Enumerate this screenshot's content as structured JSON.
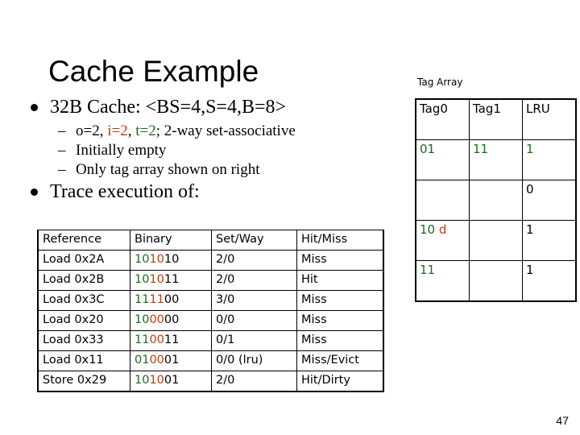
{
  "slide": {
    "title": "Cache Example",
    "page_number": "47"
  },
  "colors": {
    "tag_green": "#1a6b22",
    "index_red": "#c03b10",
    "text_black": "#000000",
    "background": "#ffffff"
  },
  "body": {
    "bullet1": {
      "text": "32B Cache: <BS=4,S=4,B=8>"
    },
    "sub_bullets": [
      {
        "dash": "–",
        "parts": [
          {
            "text": "o=2, ",
            "color": "black"
          },
          {
            "text": "i=2",
            "color": "red"
          },
          {
            "text": ", ",
            "color": "black"
          },
          {
            "text": "t=2",
            "color": "green"
          },
          {
            "text": "; 2-way set-associative",
            "color": "black"
          }
        ],
        "plain": "o=2, i=2, t=2; 2-way set-associative"
      },
      {
        "dash": "–",
        "plain": "Initially empty"
      },
      {
        "dash": "–",
        "plain": "Only tag array shown on right"
      }
    ],
    "bullet2": {
      "text": "Trace execution of:"
    }
  },
  "trace_table": {
    "headers": [
      "Reference",
      "Binary",
      "Set/Way",
      "Hit/Miss"
    ],
    "rows": [
      {
        "reference": "Load 0x2A",
        "binary": "101010",
        "binary_tag": "10",
        "binary_index": "10",
        "binary_offset": "10",
        "set_way": "2/0",
        "hit_miss": "Miss"
      },
      {
        "reference": "Load 0x2B",
        "binary": "101011",
        "binary_tag": "10",
        "binary_index": "10",
        "binary_offset": "11",
        "set_way": "2/0",
        "hit_miss": "Hit"
      },
      {
        "reference": "Load 0x3C",
        "binary": "111100",
        "binary_tag": "11",
        "binary_index": "11",
        "binary_offset": "00",
        "set_way": "3/0",
        "hit_miss": "Miss"
      },
      {
        "reference": "Load 0x20",
        "binary": "100000",
        "binary_tag": "10",
        "binary_index": "00",
        "binary_offset": "00",
        "set_way": "0/0",
        "hit_miss": "Miss"
      },
      {
        "reference": "Load 0x33",
        "binary": "110011",
        "binary_tag": "11",
        "binary_index": "00",
        "binary_offset": "11",
        "set_way": "0/1",
        "hit_miss": "Miss"
      },
      {
        "reference": "Load 0x11",
        "binary": "010001",
        "binary_tag": "01",
        "binary_index": "00",
        "binary_offset": "01",
        "set_way": "0/0 (lru)",
        "hit_miss": "Miss/Evict"
      },
      {
        "reference": "Store 0x29",
        "binary": "101001",
        "binary_tag": "10",
        "binary_index": "10",
        "binary_offset": "01",
        "set_way": "2/0",
        "hit_miss": "Hit/Dirty"
      }
    ]
  },
  "tag_array": {
    "label": "Tag Array",
    "headers": [
      "Tag0",
      "Tag1",
      "LRU"
    ],
    "rows": [
      {
        "tag0": "01",
        "tag0_color": "green",
        "tag0_dirty": "",
        "tag1": "11",
        "tag1_color": "green",
        "lru": "1",
        "lru_color": "green"
      },
      {
        "tag0": "",
        "tag0_color": "black",
        "tag0_dirty": "",
        "tag1": "",
        "tag1_color": "black",
        "lru": "0",
        "lru_color": "black"
      },
      {
        "tag0": "10",
        "tag0_color": "green",
        "tag0_dirty": "d",
        "tag1": "",
        "tag1_color": "black",
        "lru": "1",
        "lru_color": "black"
      },
      {
        "tag0": "11",
        "tag0_color": "green",
        "tag0_dirty": "",
        "tag1": "",
        "tag1_color": "black",
        "lru": "1",
        "lru_color": "black"
      }
    ]
  }
}
